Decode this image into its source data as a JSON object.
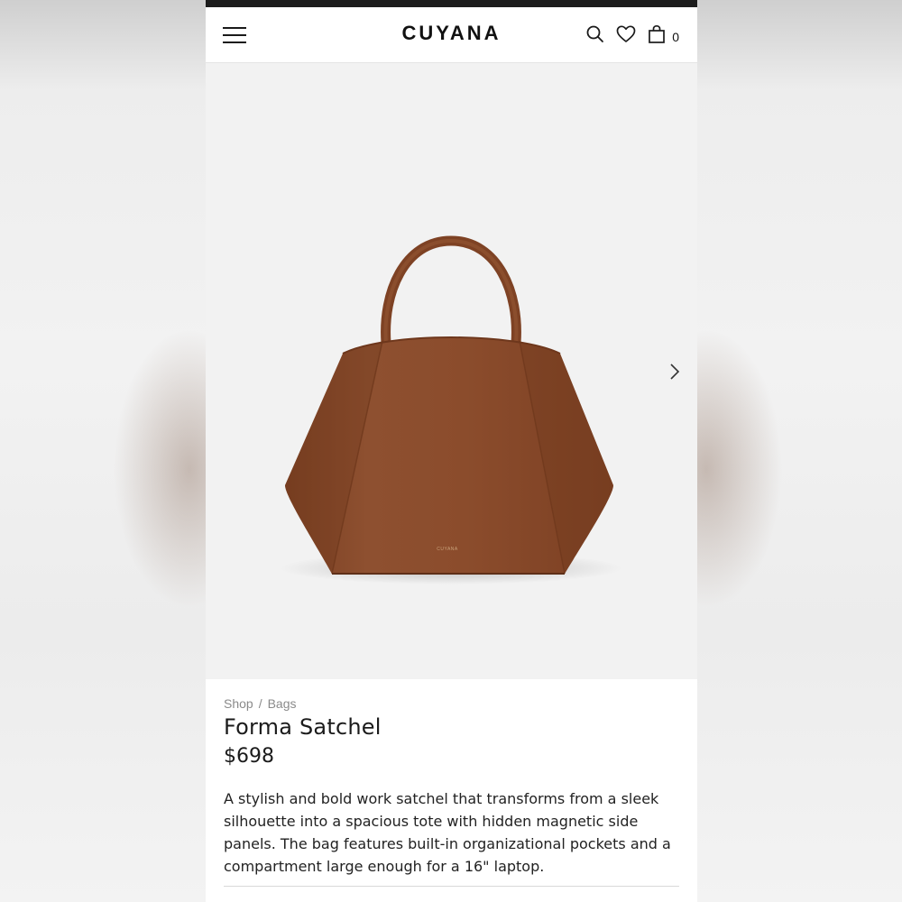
{
  "header": {
    "logo": "CUYANA",
    "cart_count": "0"
  },
  "product": {
    "image_mark": "CUYANA",
    "breadcrumb": [
      "Shop",
      "Bags"
    ],
    "breadcrumb_sep": "/",
    "title": "Forma Satchel",
    "price": "$698",
    "description": "A stylish and bold work satchel that transforms from a sleek silhouette into a spacious tote with hidden magnetic side panels. The bag features built-in organizational pockets and a compartment large enough for a 16\" laptop."
  },
  "colors": {
    "bag": "#8a4b2b",
    "status_bar": "#1c1c1c",
    "hero_bg": "#f2f2f2"
  },
  "icons": [
    "hamburger-menu-icon",
    "search-icon",
    "heart-icon",
    "shopping-bag-icon",
    "chevron-right-icon"
  ]
}
